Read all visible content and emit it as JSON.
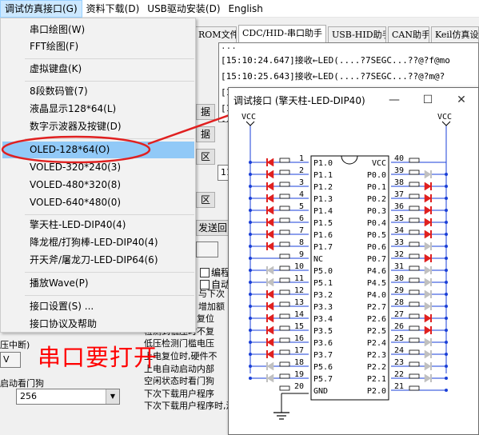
{
  "menubar": {
    "items": [
      {
        "label": "调试仿真接口(G)"
      },
      {
        "label": "资料下载(D)"
      },
      {
        "label": "USB驱动安装(D)"
      },
      {
        "label": "English"
      }
    ]
  },
  "background": {
    "tabs": [
      {
        "label": "ROM文件"
      },
      {
        "label": "CDC/HID-串口助手"
      },
      {
        "label": "USB-HID助手"
      },
      {
        "label": "CAN助手"
      },
      {
        "label": "Keil仿真设"
      }
    ],
    "log_lines": [
      "...",
      "[15:10:24.647]接收←LED(....?7SEGC...??@?f@mo",
      "[15:10:25.643]接收←LED(....?7SEGC...??@?m@?",
      "[1",
      "[1",
      "[1"
    ],
    "buttons": [
      "据",
      "据",
      "区",
      "区",
      "发送回"
    ],
    "field_text": "11",
    "checkboxes": [
      {
        "label": "编程"
      },
      {
        "label": "自动"
      }
    ],
    "notes": [
      "与下次",
      "增加额",
      "复位引脚仍为复位",
      "检测到低压时不复",
      "低压检测门槛电压",
      "上电复位时,硬件不",
      "上电自动启动内部",
      "空闲状态时看门狗",
      "下次下载用户程序",
      "下次下载用户程序时,没有相关的端口控制RS"
    ],
    "left_labels": [
      "压中断)",
      "V",
      "启动看门狗"
    ],
    "combo_value": "256",
    "annotation_text": "串口要打开"
  },
  "dropdown": {
    "items": [
      {
        "label": "串口绘图(W)"
      },
      {
        "label": "FFT绘图(F)"
      },
      {
        "label": "虚拟键盘(K)"
      },
      {
        "label": "8段数码管(7)"
      },
      {
        "label": "液晶显示128*64(L)"
      },
      {
        "label": "数字示波器及按键(D)"
      },
      {
        "label": "OLED-128*64(O)"
      },
      {
        "label": "VOLED-320*240(3)"
      },
      {
        "label": "VOLED-480*320(8)"
      },
      {
        "label": "VOLED-640*480(0)"
      },
      {
        "label": "擎天柱-LED-DIP40(4)"
      },
      {
        "label": "降龙棍/打狗棒-LED-DIP40(4)"
      },
      {
        "label": "开天斧/屠龙刀-LED-DIP64(6)"
      },
      {
        "label": "播放Wave(P)"
      },
      {
        "label": "接口设置(S) ..."
      },
      {
        "label": "接口协议及帮助"
      }
    ]
  },
  "debug_window": {
    "title": "调试接口 (擎天柱-LED-DIP40)",
    "minimize": "—",
    "maximize": "☐",
    "close": "✕",
    "vcc_left": "VCC",
    "vcc_right": "VCC",
    "left_pins": [
      {
        "num": "1",
        "name": "P1.0",
        "led": "red"
      },
      {
        "num": "2",
        "name": "P1.1",
        "led": "red"
      },
      {
        "num": "3",
        "name": "P1.2",
        "led": "red"
      },
      {
        "num": "4",
        "name": "P1.3",
        "led": "red"
      },
      {
        "num": "5",
        "name": "P1.4",
        "led": "red"
      },
      {
        "num": "6",
        "name": "P1.5",
        "led": "red"
      },
      {
        "num": "7",
        "name": "P1.6",
        "led": "red"
      },
      {
        "num": "8",
        "name": "P1.7",
        "led": "red"
      },
      {
        "num": "9",
        "name": "NC",
        "led": "none"
      },
      {
        "num": "10",
        "name": "P5.0",
        "led": "gray"
      },
      {
        "num": "11",
        "name": "P5.1",
        "led": "gray"
      },
      {
        "num": "12",
        "name": "P3.2",
        "led": "red"
      },
      {
        "num": "13",
        "name": "P3.3",
        "led": "red"
      },
      {
        "num": "14",
        "name": "P3.4",
        "led": "red"
      },
      {
        "num": "15",
        "name": "P3.5",
        "led": "red"
      },
      {
        "num": "16",
        "name": "P3.6",
        "led": "red"
      },
      {
        "num": "17",
        "name": "P3.7",
        "led": "red"
      },
      {
        "num": "18",
        "name": "P5.6",
        "led": "gray"
      },
      {
        "num": "19",
        "name": "P5.7",
        "led": "gray"
      },
      {
        "num": "20",
        "name": "GND",
        "led": "none"
      }
    ],
    "right_pins": [
      {
        "num": "40",
        "name": "VCC",
        "led": "none"
      },
      {
        "num": "39",
        "name": "P0.0",
        "led": "gray"
      },
      {
        "num": "38",
        "name": "P0.1",
        "led": "red"
      },
      {
        "num": "37",
        "name": "P0.2",
        "led": "red"
      },
      {
        "num": "36",
        "name": "P0.3",
        "led": "red"
      },
      {
        "num": "35",
        "name": "P0.4",
        "led": "red"
      },
      {
        "num": "34",
        "name": "P0.5",
        "led": "red"
      },
      {
        "num": "33",
        "name": "P0.6",
        "led": "gray"
      },
      {
        "num": "32",
        "name": "P0.7",
        "led": "red"
      },
      {
        "num": "31",
        "name": "P4.6",
        "led": "gray"
      },
      {
        "num": "30",
        "name": "P4.5",
        "led": "gray"
      },
      {
        "num": "29",
        "name": "P4.0",
        "led": "gray"
      },
      {
        "num": "28",
        "name": "P2.7",
        "led": "gray"
      },
      {
        "num": "27",
        "name": "P2.6",
        "led": "red"
      },
      {
        "num": "26",
        "name": "P2.5",
        "led": "red"
      },
      {
        "num": "25",
        "name": "P2.4",
        "led": "gray"
      },
      {
        "num": "24",
        "name": "P2.3",
        "led": "gray"
      },
      {
        "num": "23",
        "name": "P2.2",
        "led": "gray"
      },
      {
        "num": "22",
        "name": "P2.1",
        "led": "gray"
      },
      {
        "num": "21",
        "name": "P2.0",
        "led": "none"
      }
    ]
  },
  "colors": {
    "led_red": "#e02020",
    "led_gray": "#c0c0c0",
    "wire_blue": "#1a3fd8",
    "highlight": "#91c9f7",
    "annotation_red": "#e02020"
  }
}
